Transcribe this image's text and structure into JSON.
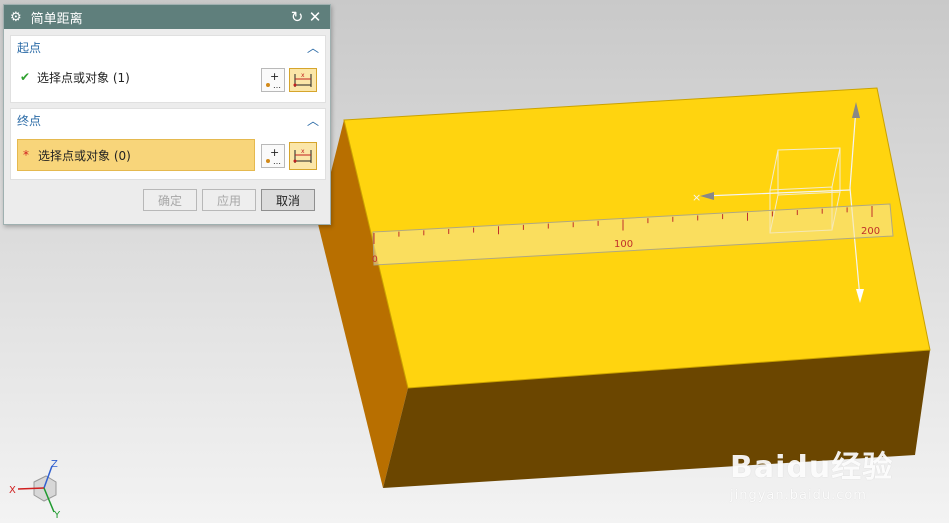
{
  "dialog": {
    "title": "简单距离",
    "icons": {
      "settings": "gear-icon",
      "reset": "refresh-icon",
      "close": "close-icon"
    },
    "start_group": {
      "header": "起点",
      "row_label": "选择点或对象 (1)",
      "status_icon": "check-icon"
    },
    "end_group": {
      "header": "终点",
      "row_label": "选择点或对象 (0)",
      "status_icon": "asterisk-icon"
    },
    "buttons": {
      "ok": "确定",
      "apply": "应用",
      "cancel": "取消"
    }
  },
  "ruler": {
    "label_100": "100",
    "label_200": "200",
    "label_0": "0"
  },
  "triad": {
    "z": "Z",
    "x": "X",
    "y": "Y"
  },
  "watermark": {
    "brand": "Baidu经验",
    "url": "jingyan.baidu.com"
  },
  "colors": {
    "box_top": "#ffd40f",
    "box_front": "#6b4600",
    "box_left": "#b86f00",
    "titlebar": "#5f7f7c",
    "header_text": "#2a6aa6",
    "active_row": "#f8d57a"
  }
}
